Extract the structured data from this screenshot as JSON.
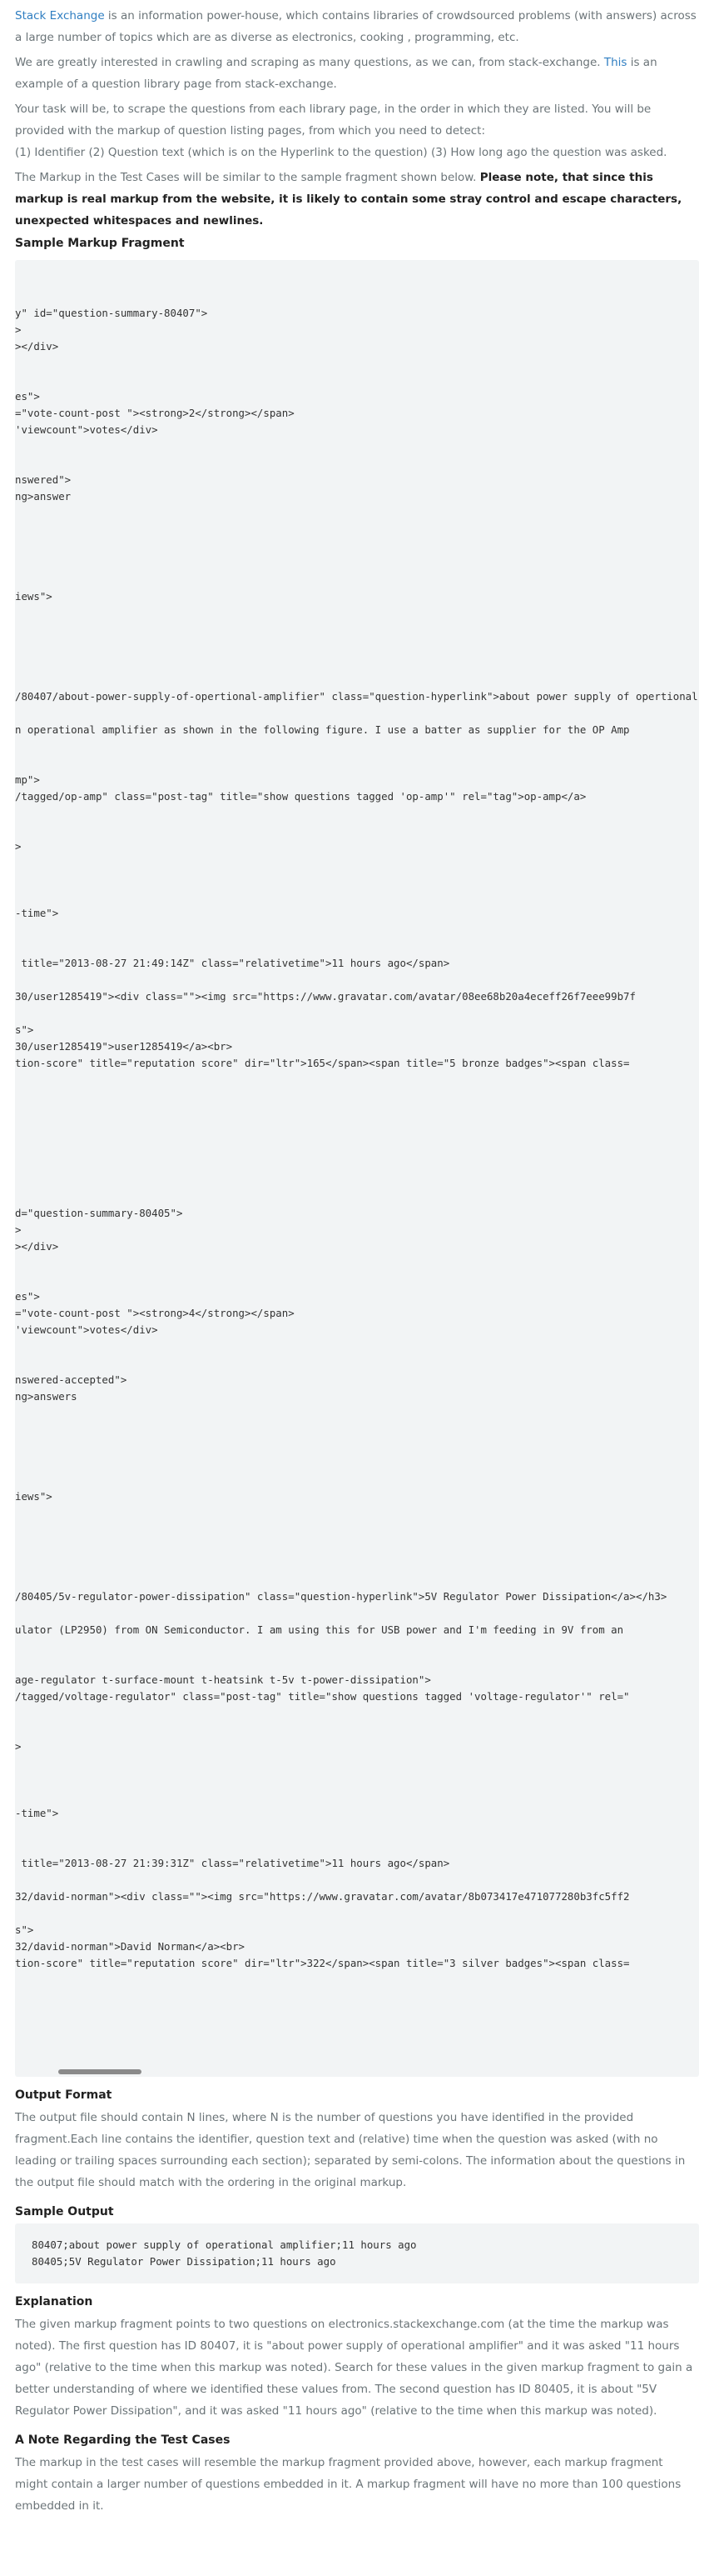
{
  "intro": {
    "p1_link": "Stack Exchange",
    "p1_text": " is an information power-house, which contains libraries of crowdsourced problems (with answers) across a large number of topics which are as diverse as electronics, cooking , programming, etc.",
    "p2_pre": "We are greatly interested in crawling and scraping as many questions, as we can, from stack-exchange. ",
    "p2_link": "This",
    "p2_post": " is an example of a question library page from stack-exchange.",
    "p3": "Your task will be, to scrape the questions from each library page, in the order in which they are listed. You will be provided with the markup of question listing pages, from which you need to detect:",
    "p4": "(1) Identifier (2) Question text (which is on the Hyperlink to the question) (3) How long ago the question was asked.",
    "p5_pre": "The Markup in the Test Cases will be similar to the sample fragment shown below. ",
    "p5_bold": "Please note, that since this markup is real markup from the website, it is likely to contain some stray control and escape characters, unexpected whitespaces and newlines."
  },
  "sample_markup": {
    "heading": "Sample Markup Fragment",
    "code": "\n\ny\" id=\"question-summary-80407\">\n>\n></div>\n\n\nes\">\n=\"vote-count-post \"><strong>2</strong></span>\n'viewcount\">votes</div>\n\n\nnswered\">\nng>answer\n\n\n\n\n\niews\">\n\n\n\n\n\n/80407/about-power-supply-of-opertional-amplifier\" class=\"question-hyperlink\">about power supply of opertional amplifier</a></h3>\n\nn operational amplifier as shown in the following figure. I use a batter as supplier for the OP Amp\n\n\nmp\">\n/tagged/op-amp\" class=\"post-tag\" title=\"show questions tagged 'op-amp'\" rel=\"tag\">op-amp</a>\n\n\n>\n\n\n\n-time\">\n\n\n title=\"2013-08-27 21:49:14Z\" class=\"relativetime\">11 hours ago</span>\n\n30/user1285419\"><div class=\"\"><img src=\"https://www.gravatar.com/avatar/08ee68b20a4eceff26f7eee99b7f\n\ns\">\n30/user1285419\">user1285419</a><br>\ntion-score\" title=\"reputation score\" dir=\"ltr\">165</span><span title=\"5 bronze badges\"><span class=\n\n\n\n\n\n\n\n\nd=\"question-summary-80405\">\n>\n></div>\n\n\nes\">\n=\"vote-count-post \"><strong>4</strong></span>\n'viewcount\">votes</div>\n\n\nnswered-accepted\">\nng>answers\n\n\n\n\n\niews\">\n\n\n\n\n\n/80405/5v-regulator-power-dissipation\" class=\"question-hyperlink\">5V Regulator Power Dissipation</a></h3>\n\nulator (LP2950) from ON Semiconductor. I am using this for USB power and I'm feeding in 9V from an\n\n\nage-regulator t-surface-mount t-heatsink t-5v t-power-dissipation\">\n/tagged/voltage-regulator\" class=\"post-tag\" title=\"show questions tagged 'voltage-regulator'\" rel=\"\n\n\n>\n\n\n\n-time\">\n\n\n title=\"2013-08-27 21:39:31Z\" class=\"relativetime\">11 hours ago</span>\n\n32/david-norman\"><div class=\"\"><img src=\"https://www.gravatar.com/avatar/8b073417e471077280b3fc5ff2\n\ns\">\n32/david-norman\">David Norman</a><br>\ntion-score\" title=\"reputation score\" dir=\"ltr\">322</span><span title=\"3 silver badges\"><span class=\n"
  },
  "output_format": {
    "heading": "Output Format",
    "text": "The output file should contain N lines, where N is the number of questions you have identified in the provided fragment.Each line contains the identifier, question text and (relative) time when the question was asked (with no leading or trailing spaces surrounding each section); separated by semi-colons. The information about the questions in the output file should match with the ordering in the original markup."
  },
  "sample_output": {
    "heading": "Sample Output",
    "code": "80407;about power supply of operational amplifier;11 hours ago\n80405;5V Regulator Power Dissipation;11 hours ago"
  },
  "explanation": {
    "heading": "Explanation",
    "text": "The given markup fragment points to two questions on electronics.stackexchange.com (at the time the markup was noted). The first question has ID 80407, it is \"about power supply of operational amplifier\" and it was asked \"11 hours ago\" (relative to the time when this markup was noted). Search for these values in the given markup fragment to gain a better understanding of where we identified these values from. The second question has ID 80405, it is about \"5V Regulator Power Dissipation\", and it was asked \"11 hours ago\" (relative to the time when this markup was noted)."
  },
  "note": {
    "heading": "A Note Regarding the Test Cases",
    "text": "The markup in the test cases will resemble the markup fragment provided above, however, each markup fragment might contain a larger number of questions embedded in it. A markup fragment will have no more than 100 questions embedded in it."
  }
}
